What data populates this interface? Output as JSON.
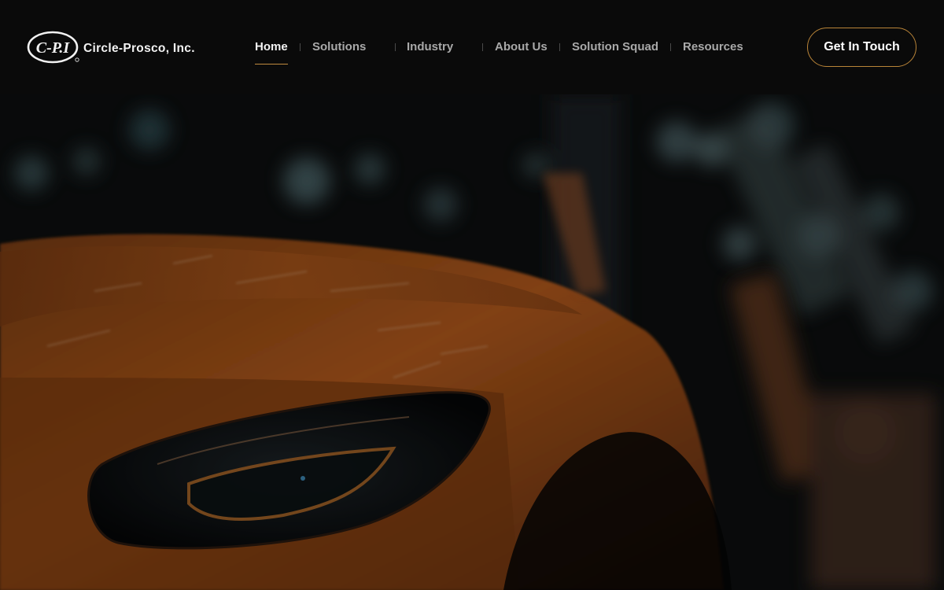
{
  "brand": {
    "logo_mark": "C-P.I",
    "name": "Circle-Prosco, Inc."
  },
  "nav": {
    "items": [
      {
        "label": "Home",
        "active": true
      },
      {
        "label": "Solutions",
        "active": false
      },
      {
        "label": "Industry",
        "active": false
      },
      {
        "label": "About Us",
        "active": false
      },
      {
        "label": "Solution Squad",
        "active": false
      },
      {
        "label": "Resources",
        "active": false
      }
    ]
  },
  "cta": {
    "label": "Get In Touch"
  },
  "colors": {
    "header_bg": "#0a0a0a",
    "accent": "#c08b3e",
    "car_orange": "#c4661c"
  },
  "hero": {
    "image_subject": "orange-sports-car-headlight"
  }
}
